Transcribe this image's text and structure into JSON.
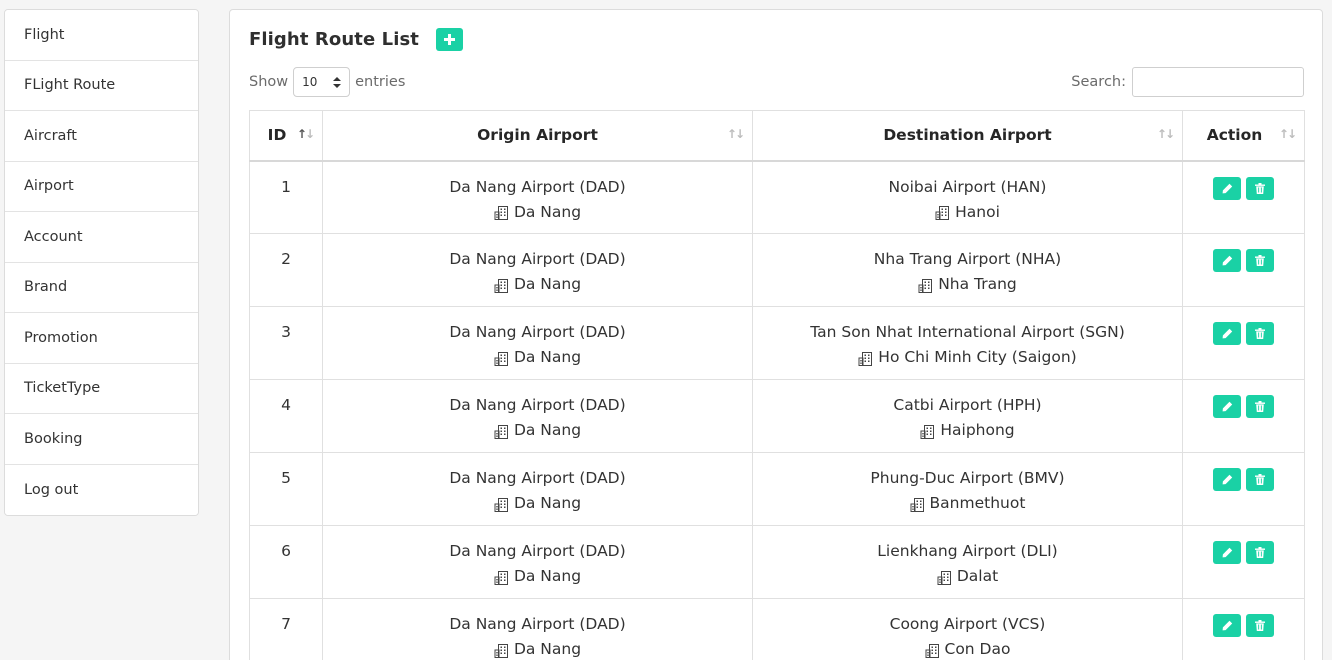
{
  "sidebar": {
    "items": [
      {
        "label": "Flight"
      },
      {
        "label": "FLight Route"
      },
      {
        "label": "Aircraft"
      },
      {
        "label": "Airport"
      },
      {
        "label": "Account"
      },
      {
        "label": "Brand"
      },
      {
        "label": "Promotion"
      },
      {
        "label": "TicketType"
      },
      {
        "label": "Booking"
      },
      {
        "label": "Log out"
      }
    ]
  },
  "header": {
    "title": "Flight Route List"
  },
  "controls": {
    "show_label": "Show",
    "page_size": "10",
    "entries_label": "entries",
    "search_label": "Search:",
    "search_value": ""
  },
  "table": {
    "columns": [
      "ID",
      "Origin Airport",
      "Destination Airport",
      "Action"
    ],
    "rows": [
      {
        "id": "1",
        "origin_airport": "Da Nang Airport (DAD)",
        "origin_city": "Da Nang",
        "dest_airport": "Noibai Airport (HAN)",
        "dest_city": "Hanoi"
      },
      {
        "id": "2",
        "origin_airport": "Da Nang Airport (DAD)",
        "origin_city": "Da Nang",
        "dest_airport": "Nha Trang Airport (NHA)",
        "dest_city": "Nha Trang"
      },
      {
        "id": "3",
        "origin_airport": "Da Nang Airport (DAD)",
        "origin_city": "Da Nang",
        "dest_airport": "Tan Son Nhat International Airport (SGN)",
        "dest_city": "Ho Chi Minh City (Saigon)"
      },
      {
        "id": "4",
        "origin_airport": "Da Nang Airport (DAD)",
        "origin_city": "Da Nang",
        "dest_airport": "Catbi Airport (HPH)",
        "dest_city": "Haiphong"
      },
      {
        "id": "5",
        "origin_airport": "Da Nang Airport (DAD)",
        "origin_city": "Da Nang",
        "dest_airport": "Phung-Duc Airport (BMV)",
        "dest_city": "Banmethuot"
      },
      {
        "id": "6",
        "origin_airport": "Da Nang Airport (DAD)",
        "origin_city": "Da Nang",
        "dest_airport": "Lienkhang Airport (DLI)",
        "dest_city": "Dalat"
      },
      {
        "id": "7",
        "origin_airport": "Da Nang Airport (DAD)",
        "origin_city": "Da Nang",
        "dest_airport": "Coong Airport (VCS)",
        "dest_city": "Con Dao"
      }
    ]
  },
  "icons": {
    "add": "plus-icon",
    "edit": "pencil-icon",
    "delete": "trash-icon",
    "city": "building-icon",
    "sort": "sort-arrows-icon"
  },
  "colors": {
    "accent": "#1ad1a5",
    "text": "#333333",
    "border": "#e0e0e0"
  }
}
